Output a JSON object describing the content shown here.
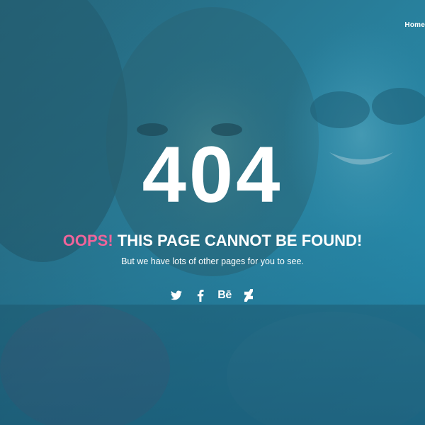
{
  "nav": {
    "home_label": "Home"
  },
  "error": {
    "code": "404",
    "headline_accent": "OOPS!",
    "headline_rest": " THIS PAGE CANNOT BE FOUND!",
    "subtext": "But we have lots of other pages for you to see."
  },
  "social": [
    {
      "icon": "twitter-icon"
    },
    {
      "icon": "facebook-icon"
    },
    {
      "icon": "behance-icon",
      "label": "Bē"
    },
    {
      "icon": "deviantart-icon"
    }
  ],
  "colors": {
    "accent": "#f0649a",
    "text": "#ffffff",
    "background": "#2f8aa3"
  }
}
